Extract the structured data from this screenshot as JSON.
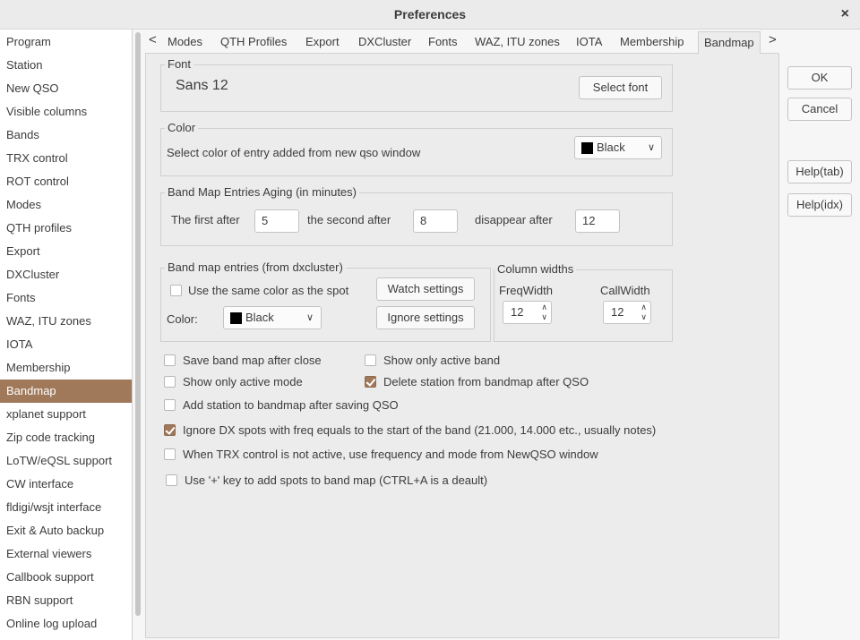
{
  "window": {
    "title": "Preferences",
    "close_glyph": "×"
  },
  "sidebar": {
    "items": [
      {
        "label": "Program"
      },
      {
        "label": "Station"
      },
      {
        "label": "New QSO"
      },
      {
        "label": "Visible columns"
      },
      {
        "label": "Bands"
      },
      {
        "label": "TRX control"
      },
      {
        "label": "ROT control"
      },
      {
        "label": "Modes"
      },
      {
        "label": "QTH profiles"
      },
      {
        "label": "Export"
      },
      {
        "label": "DXCluster"
      },
      {
        "label": "Fonts"
      },
      {
        "label": "WAZ, ITU zones"
      },
      {
        "label": "IOTA"
      },
      {
        "label": "Membership"
      },
      {
        "label": "Bandmap"
      },
      {
        "label": "xplanet support"
      },
      {
        "label": "Zip code tracking"
      },
      {
        "label": "LoTW/eQSL support"
      },
      {
        "label": "CW interface"
      },
      {
        "label": "fldigi/wsjt interface"
      },
      {
        "label": "Exit & Auto backup"
      },
      {
        "label": "External viewers"
      },
      {
        "label": "Callbook support"
      },
      {
        "label": "RBN support"
      },
      {
        "label": "Online log upload"
      }
    ],
    "active": "Bandmap"
  },
  "tabs": {
    "left_arrow": "<",
    "right_arrow": ">",
    "items": [
      "Modes",
      "QTH Profiles",
      "Export",
      "DXCluster",
      "Fonts",
      "WAZ, ITU zones",
      "IOTA",
      "Membership",
      "Bandmap"
    ],
    "active": "Bandmap"
  },
  "font_group": {
    "legend": "Font",
    "current": "Sans 12",
    "button": "Select font"
  },
  "color_group": {
    "legend": "Color",
    "label": "Select color of entry added from new qso window",
    "value": "Black"
  },
  "aging_group": {
    "legend": "Band Map Entries Aging (in minutes)",
    "first_label": "The first after",
    "first_value": "5",
    "second_label": "the second after",
    "second_value": "8",
    "disappear_label": "disappear after",
    "disappear_value": "12"
  },
  "entries_group": {
    "legend": "Band map entries (from dxcluster)",
    "same_color_label": "Use the same color as the spot",
    "same_color_checked": false,
    "watch_button": "Watch settings",
    "ignore_button": "Ignore settings",
    "color_label": "Color:",
    "color_value": "Black"
  },
  "widths_group": {
    "legend": "Column widths",
    "freq_label": "FreqWidth",
    "freq_value": "12",
    "call_label": "CallWidth",
    "call_value": "12"
  },
  "options": {
    "save_band_map": {
      "label": "Save band map after close",
      "checked": false
    },
    "show_active_band": {
      "label": "Show only active band",
      "checked": false
    },
    "show_active_mode": {
      "label": "Show only active mode",
      "checked": false
    },
    "delete_station": {
      "label": "Delete station from bandmap after QSO",
      "checked": true
    },
    "add_station": {
      "label": "Add station to bandmap after saving QSO",
      "checked": false
    },
    "ignore_dx": {
      "label": "Ignore DX spots with freq equals to the start of the band (21.000, 14.000 etc., usually notes)",
      "checked": true
    },
    "trx_inactive": {
      "label": "When TRX control is not active, use frequency and mode from NewQSO window",
      "checked": false
    },
    "plus_key": {
      "label": "Use '+' key to add spots to band map (CTRL+A is a deault)",
      "checked": false
    }
  },
  "buttons": {
    "ok": "OK",
    "cancel": "Cancel",
    "help_tab": "Help(tab)",
    "help_idx": "Help(idx)"
  },
  "colors": {
    "accent": "#a0785a",
    "swatch": "#000000"
  }
}
